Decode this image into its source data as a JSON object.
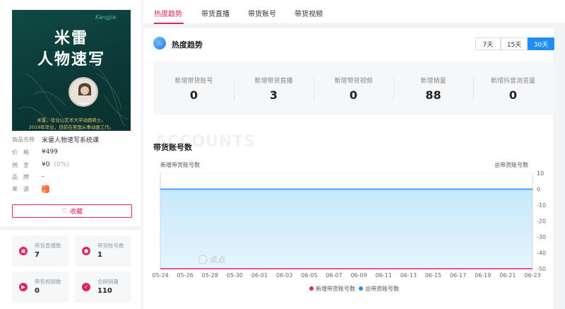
{
  "product": {
    "cover": {
      "signature": "Kangjie",
      "title_line1": "米雷",
      "title_line2": "人物速写",
      "caption_line1": "米雷，毕业山艺术大学动画硕士。",
      "caption_line2": "2019年毕业，目前在美国从事动画工作。"
    },
    "labels": {
      "name": "商品名称",
      "price": "价　格",
      "commission": "佣　金",
      "brand": "品　牌",
      "source": "来　源"
    },
    "name": "米雷人物速写系统课",
    "price": "¥499",
    "commission": "¥0",
    "commission_rate": "(0%)",
    "brand": "-",
    "source_icon_text": "小店"
  },
  "favorite_label": "收藏",
  "stats": [
    {
      "label": "带货直播数",
      "value": "7",
      "icon": "live-icon",
      "color": "#e0245e"
    },
    {
      "label": "带货账号数",
      "value": "1",
      "icon": "user-icon",
      "color": "#e0245e"
    },
    {
      "label": "带货视频数",
      "value": "0",
      "icon": "video-icon",
      "color": "#e0245e"
    },
    {
      "label": "全网销量",
      "value": "110",
      "icon": "sales-icon",
      "color": "#e0245e"
    }
  ],
  "tabs": [
    {
      "label": "热度趋势",
      "active": true
    },
    {
      "label": "带货直播",
      "active": false
    },
    {
      "label": "带货账号",
      "active": false
    },
    {
      "label": "带货视频",
      "active": false
    }
  ],
  "section_title": "热度趋势",
  "ranges": [
    {
      "label": "7天",
      "active": false
    },
    {
      "label": "15天",
      "active": false
    },
    {
      "label": "30天",
      "active": true
    }
  ],
  "metrics": [
    {
      "label": "新增带货账号",
      "value": "0"
    },
    {
      "label": "新增带货直播",
      "value": "3"
    },
    {
      "label": "新增带货视频",
      "value": "0"
    },
    {
      "label": "新增销量",
      "value": "88"
    },
    {
      "label": "新增抖音浏览量",
      "value": "0"
    }
  ],
  "watermark_text": "ACCOUNTS",
  "chart_title": "带货账号数",
  "chart_logo_text": "点点",
  "colors": {
    "accent": "#e0245e",
    "blue": "#1f8ff5",
    "area_fill": "#d6eefc"
  },
  "chart_data": {
    "type": "line",
    "x": [
      "05-24",
      "05-25",
      "05-26",
      "05-27",
      "05-28",
      "05-29",
      "05-30",
      "05-31",
      "06-01",
      "06-02",
      "06-03",
      "06-04",
      "06-05",
      "06-06",
      "06-07",
      "06-08",
      "06-09",
      "06-10",
      "06-11",
      "06-12",
      "06-13",
      "06-14",
      "06-15",
      "06-16",
      "06-17",
      "06-18",
      "06-19",
      "06-20",
      "06-21",
      "06-22",
      "06-23"
    ],
    "x_tick_labels": [
      "05-24",
      "05-26",
      "05-28",
      "05-30",
      "06-01",
      "06-03",
      "06-05",
      "06-07",
      "06-09",
      "06-11",
      "06-13",
      "06-15",
      "06-17",
      "06-19",
      "06-21",
      "06-23"
    ],
    "left_axis_label": "新增带货账号数",
    "right_axis_label": "总带货账号数",
    "y_right_ticks": [
      10,
      0,
      -10,
      -20,
      -30,
      -40,
      -50
    ],
    "y_right_range": [
      -50,
      10
    ],
    "series": [
      {
        "name": "新增带货账号数",
        "color": "#e0245e",
        "axis": "left",
        "values": [
          0,
          0,
          0,
          0,
          0,
          0,
          0,
          0,
          0,
          0,
          0,
          0,
          0,
          0,
          0,
          0,
          0,
          0,
          0,
          0,
          0,
          0,
          0,
          0,
          0,
          0,
          0,
          0,
          0,
          0,
          0
        ]
      },
      {
        "name": "总带货账号数",
        "color": "#1f8ff5",
        "axis": "right",
        "values": [
          0,
          0,
          0,
          0,
          0,
          0,
          0,
          0,
          0,
          0,
          0,
          0,
          0,
          0,
          0,
          0,
          0,
          0,
          0,
          0,
          0,
          0,
          0,
          0,
          0,
          0,
          0,
          0,
          0,
          0,
          0
        ]
      }
    ],
    "legend_position": "bottom-center",
    "grid": true
  }
}
